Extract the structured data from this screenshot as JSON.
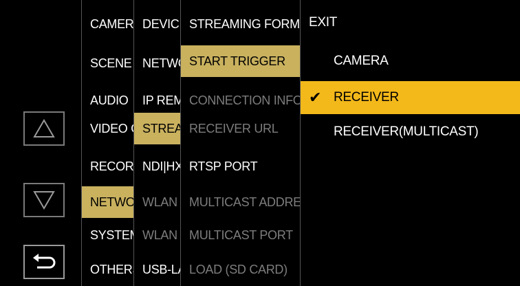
{
  "nav": {
    "up_icon": "triangle-up-icon",
    "down_icon": "triangle-down-icon",
    "back_icon": "return-arrow-icon"
  },
  "col1": [
    "CAMERA",
    "SCENE",
    "AUDIO",
    "VIDEO OUT",
    "RECORDING",
    "NETWORK",
    "SYSTEM",
    "OTHERS"
  ],
  "col2": [
    "DEVICE",
    "NETWORK",
    "IP REMOTE",
    "STREAMING",
    "NDI|HX",
    "WLAN",
    "WLAN",
    "USB-LAN"
  ],
  "col3": [
    "STREAMING FORMAT",
    "START TRIGGER",
    "CONNECTION INFO.",
    "RECEIVER URL",
    "RTSP PORT",
    "MULTICAST ADDRESS",
    "MULTICAST PORT",
    "LOAD (SD CARD)"
  ],
  "col4": {
    "exit": "EXIT",
    "options": [
      "CAMERA",
      "RECEIVER",
      "RECEIVER(MULTICAST)"
    ],
    "check": "✔"
  },
  "colors": {
    "selected_path": "#c9b15e",
    "highlight": "#f3b81a",
    "dimmed": "#7d7d7d"
  }
}
